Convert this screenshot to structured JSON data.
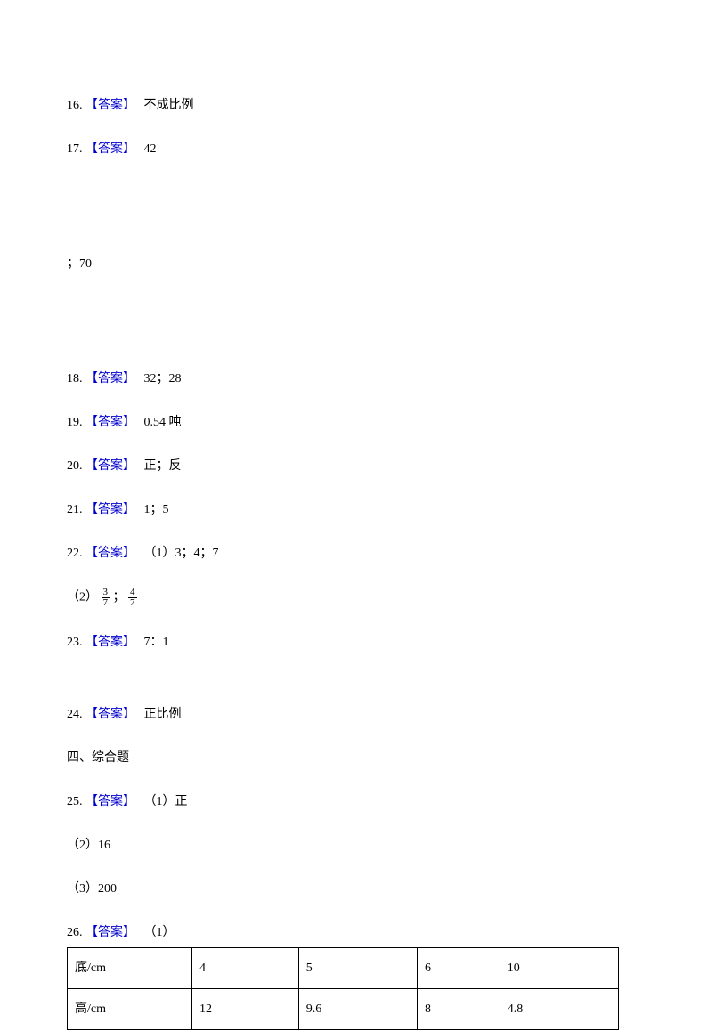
{
  "answer_label": "【答案】",
  "q16": {
    "num": "16.",
    "text": "不成比例"
  },
  "q17": {
    "num": "17.",
    "text": "42"
  },
  "q17b": "；70",
  "q18": {
    "num": "18.",
    "text": "32；28"
  },
  "q19": {
    "num": "19.",
    "text": "0.54 吨"
  },
  "q20": {
    "num": "20.",
    "text": "正；反"
  },
  "q21": {
    "num": "21.",
    "text": "1；5"
  },
  "q22": {
    "num": "22.",
    "text": "（1）3；4；7"
  },
  "q22b_prefix": "（2）",
  "q22b_f1_num": "3",
  "q22b_f1_den": "7",
  "q22b_sep": "；",
  "q22b_f2_num": "4",
  "q22b_f2_den": "7",
  "q23": {
    "num": "23.",
    "text": "7：1"
  },
  "q24": {
    "num": "24.",
    "text": "正比例"
  },
  "section4": "四、综合题",
  "q25": {
    "num": "25.",
    "text": "（1）正"
  },
  "q25b": "（2）16",
  "q25c": "（3）200",
  "q26": {
    "num": "26.",
    "text": "（1）"
  },
  "chart_data": {
    "type": "table",
    "row_headers": [
      "底/cm",
      "高/cm"
    ],
    "columns": [
      "4",
      "5",
      "6",
      "10"
    ],
    "rows": [
      [
        "4",
        "5",
        "6",
        "10"
      ],
      [
        "12",
        "9.6",
        "8",
        "4.8"
      ]
    ]
  }
}
